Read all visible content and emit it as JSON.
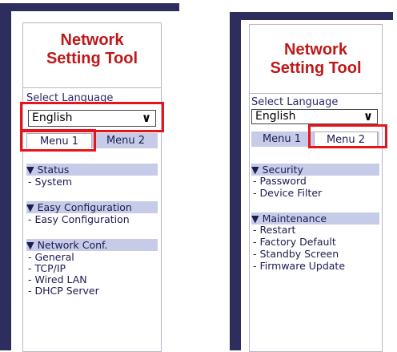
{
  "left_panel": {
    "title_line1": "Network",
    "title_line2": "Setting Tool",
    "select_language_label": "Select Language",
    "language_value": "English",
    "tabs": [
      "Menu 1",
      "Menu 2"
    ],
    "sections": [
      {
        "header": "▼ Status",
        "items": [
          "- System"
        ]
      },
      {
        "header": "▼ Easy Configuration",
        "items": [
          "- Easy Configuration"
        ]
      },
      {
        "header": "▼ Network Conf.",
        "items": [
          "- General",
          "- TCP/IP",
          "- Wired LAN",
          "- DHCP Server"
        ]
      }
    ]
  },
  "right_panel": {
    "title_line1": "Network",
    "title_line2": "Setting Tool",
    "select_language_label": "Select Language",
    "language_value": "English",
    "tabs": [
      "Menu 1",
      "Menu 2"
    ],
    "sections": [
      {
        "header": "▼ Security",
        "items": [
          "- Password",
          "- Device Filter"
        ]
      },
      {
        "header": "▼ Maintenance",
        "items": [
          "- Restart",
          "- Factory Default",
          "- Standby Screen",
          "- Firmware Update"
        ]
      }
    ]
  },
  "colors": {
    "frame": "#2e2e5e",
    "title": "#c01818",
    "tab_bar": "#c6cbe8",
    "highlight": "#e8141c"
  }
}
